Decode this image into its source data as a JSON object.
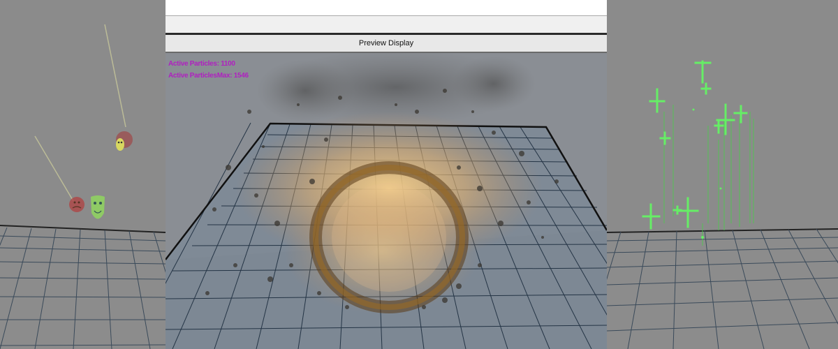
{
  "preview": {
    "title": "Preview Display",
    "active_particles": "Active Particles: 1100",
    "active_particles_max": "Active ParticlesMax: 1546"
  },
  "colors": {
    "viewport_bg": "#8b8b8b",
    "grid_line": "#2d3a4a",
    "particle_text": "#b020c0",
    "fire_core": "#e0a040",
    "green_marker": "#66ee66"
  },
  "icons": {
    "left_mask_red_1": "theater-mask-icon",
    "left_mask_red_2": "theater-mask-icon",
    "left_mask_green": "theater-mask-icon",
    "right_markers": "plus-marker-icon"
  }
}
